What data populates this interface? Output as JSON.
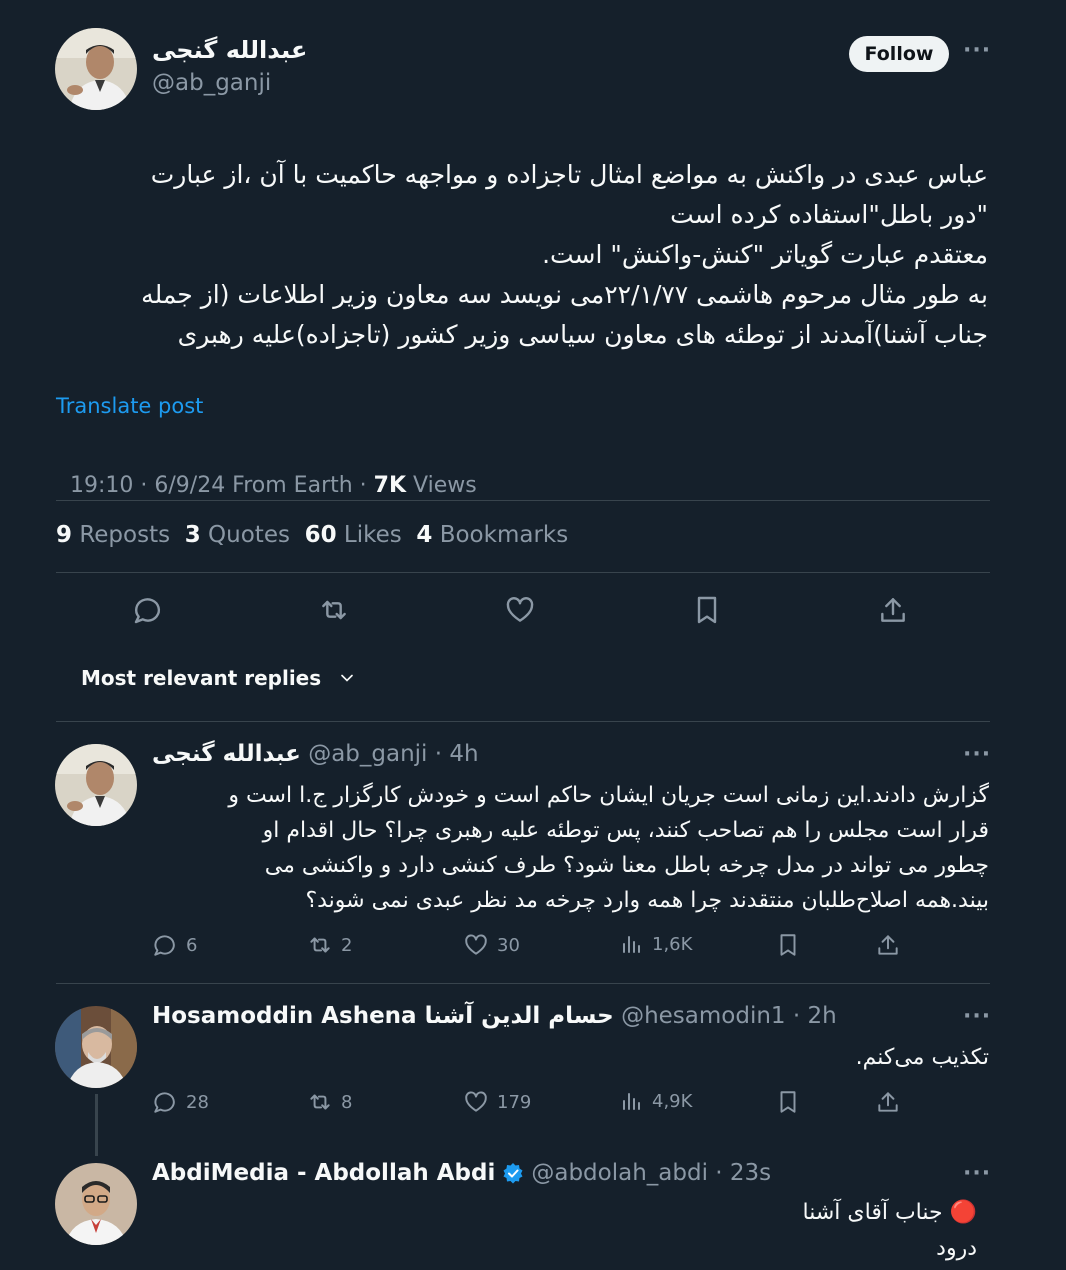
{
  "post": {
    "author_name": "عبدالله گنجی",
    "author_handle": "@ab_ganji",
    "follow_label": "Follow",
    "more_label": "···",
    "text_lines": [
      "عباس عبدی در واکنش به مواضع امثال تاجزاده و مواجهه حاکمیت با آن ،از عبارت",
      "\"دور باطل\"استفاده کرده است",
      "معتقدم عبارت گویاتر \"کنش-واکنش\" است.",
      "به طور مثال مرحوم هاشمی ۲۲/۱/۷۷می نویسد سه معاون وزیر اطلاعات (از جمله",
      "جناب آشنا)آمدند از توطئه های معاون سیاسی وزیر کشور (تاجزاده)علیه رهبری"
    ],
    "translate_label": "Translate post",
    "meta_time": "19:10 · 6/9/24 From Earth · ",
    "meta_views_num": "7K",
    "meta_views_label": " Views",
    "stats": {
      "reposts_num": "9",
      "reposts_label": "Reposts",
      "quotes_num": "3",
      "quotes_label": "Quotes",
      "likes_num": "60",
      "likes_label": "Likes",
      "bookmarks_num": "4",
      "bookmarks_label": "Bookmarks"
    },
    "sort_label": "Most relevant replies"
  },
  "replies": [
    {
      "name": "عبدالله گنجی",
      "handle_time": "@ab_ganji · 4h",
      "text_lines": [
        "گزارش دادند.این زمانی است جریان ایشان حاکم است و خودش کارگزار ج.ا است و",
        "قرار است مجلس را هم تصاحب کنند، پس توطئه علیه رهبری چرا؟ حال اقدام او",
        "چطور می تواند در مدل چرخه باطل معنا شود؟ طرف کنشی دارد و واکنشی می",
        "بیند.همه اصلاح‌طلبان منتقدند چرا همه وارد چرخه مد نظر عبدی نمی شوند؟"
      ],
      "replies": "6",
      "reposts": "2",
      "likes": "30",
      "views": "1,6K"
    },
    {
      "name": "Hosamoddin Ashena حسام الدین آشنا",
      "handle_time": "@hesamodin1 · 2h",
      "text_lines": [
        "تکذیب می‌کنم."
      ],
      "replies": "28",
      "reposts": "8",
      "likes": "179",
      "views": "4,9K"
    },
    {
      "name": "AbdiMedia - Abdollah Abdi",
      "handle_time": "@abdolah_abdi · 23s",
      "text_lines": [
        "🔴 جناب آقای آشنا",
        "درود"
      ]
    }
  ],
  "colors": {
    "bg": "#15202b",
    "link": "#1d9bf0",
    "muted": "#8b98a5",
    "verified": "#1d9bf0"
  }
}
